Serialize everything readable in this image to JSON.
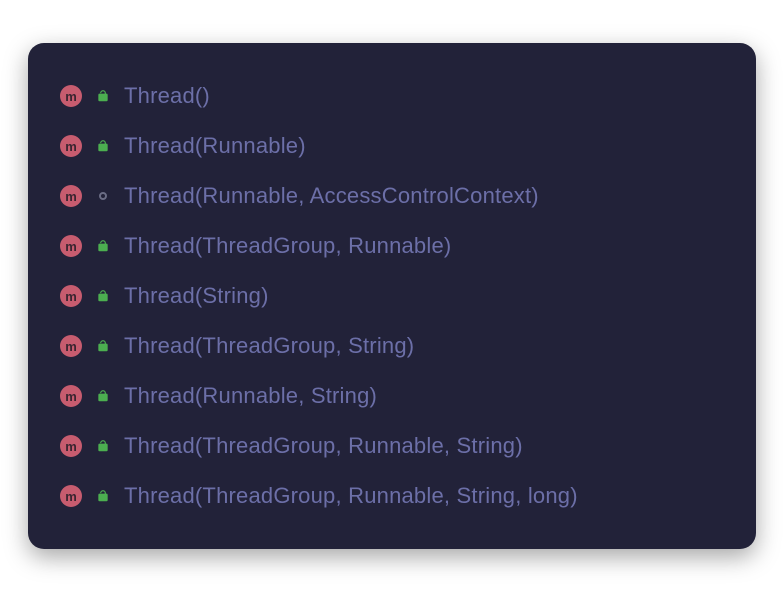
{
  "methodIconLetter": "m",
  "items": [
    {
      "visibility": "public",
      "signature": "Thread()"
    },
    {
      "visibility": "public",
      "signature": "Thread(Runnable)"
    },
    {
      "visibility": "package",
      "signature": "Thread(Runnable, AccessControlContext)"
    },
    {
      "visibility": "public",
      "signature": "Thread(ThreadGroup, Runnable)"
    },
    {
      "visibility": "public",
      "signature": "Thread(String)"
    },
    {
      "visibility": "public",
      "signature": "Thread(ThreadGroup, String)"
    },
    {
      "visibility": "public",
      "signature": "Thread(Runnable, String)"
    },
    {
      "visibility": "public",
      "signature": "Thread(ThreadGroup, Runnable, String)"
    },
    {
      "visibility": "public",
      "signature": "Thread(ThreadGroup, Runnable, String, long)"
    }
  ]
}
